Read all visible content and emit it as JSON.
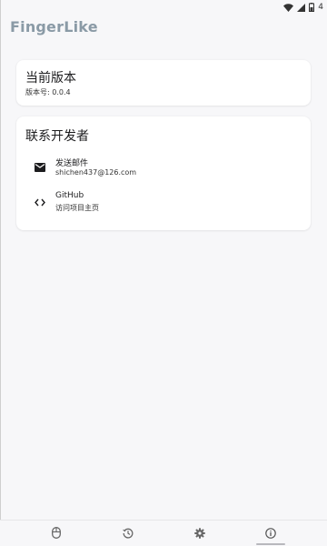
{
  "status_bar": {
    "battery_text": "4"
  },
  "app": {
    "title": "FingerLike"
  },
  "version_card": {
    "title": "当前版本",
    "version_line": "版本号: 0.0.4"
  },
  "contact_card": {
    "title": "联系开发者",
    "items": [
      {
        "icon": "mail-icon",
        "title": "发送邮件",
        "subtitle": "shichen437@126.com"
      },
      {
        "icon": "code-icon",
        "title": "GitHub",
        "subtitle": "访问项目主页"
      }
    ]
  },
  "bottom_nav": {
    "items": [
      {
        "icon": "mouse-icon"
      },
      {
        "icon": "history-icon"
      },
      {
        "icon": "settings-icon"
      },
      {
        "icon": "info-icon",
        "selected": true
      }
    ]
  },
  "colors": {
    "title": "#8a9aa6",
    "background": "#f7f7f9",
    "card": "#ffffff",
    "icon": "#666666"
  }
}
